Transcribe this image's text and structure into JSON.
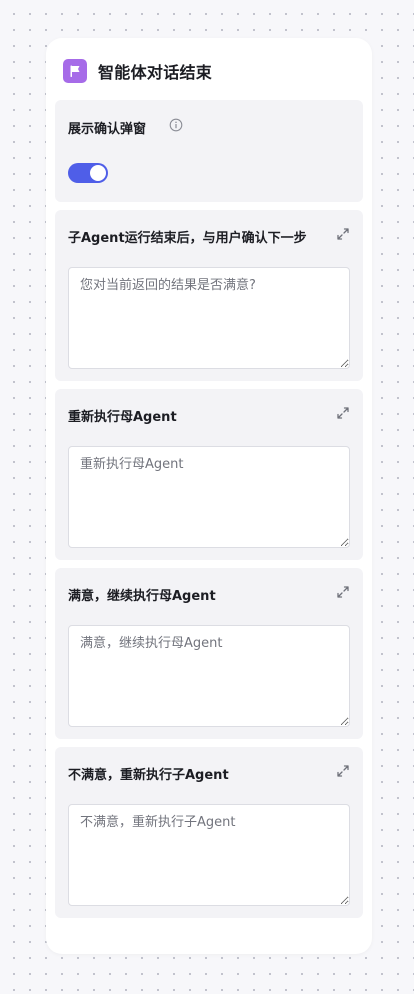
{
  "node": {
    "title": "智能体对话结束",
    "icon": "flag-icon",
    "accent_color": "#a66be8"
  },
  "confirm_popup": {
    "label": "展示确认弹窗",
    "info_icon": "info-icon",
    "enabled": true,
    "toggle_color": "#4f5ee8"
  },
  "fields": [
    {
      "label": "子Agent运行结束后，与用户确认下一步",
      "value": "",
      "placeholder": "您对当前返回的结果是否满意?",
      "icon": "expand-icon"
    },
    {
      "label": "重新执行母Agent",
      "value": "",
      "placeholder": "重新执行母Agent",
      "icon": "expand-icon"
    },
    {
      "label": "满意，继续执行母Agent",
      "value": "",
      "placeholder": "满意，继续执行母Agent",
      "icon": "expand-icon"
    },
    {
      "label": "不满意，重新执行子Agent",
      "value": "",
      "placeholder": "不满意，重新执行子Agent",
      "icon": "expand-icon"
    }
  ]
}
